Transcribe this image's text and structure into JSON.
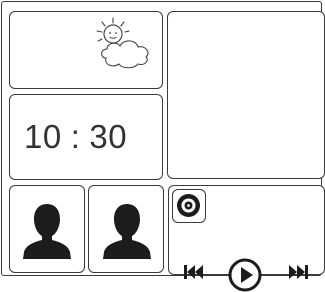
{
  "weather": {
    "icon": "sun-behind-cloud-icon"
  },
  "clock": {
    "hours": "10",
    "separator": ":",
    "minutes": "30"
  },
  "contacts": [
    {
      "icon": "person-silhouette-icon"
    },
    {
      "icon": "person-silhouette-icon"
    }
  ],
  "player": {
    "disc_icon": "disc-icon",
    "controls": [
      "previous-track-icon",
      "play-icon",
      "next-track-icon"
    ]
  }
}
